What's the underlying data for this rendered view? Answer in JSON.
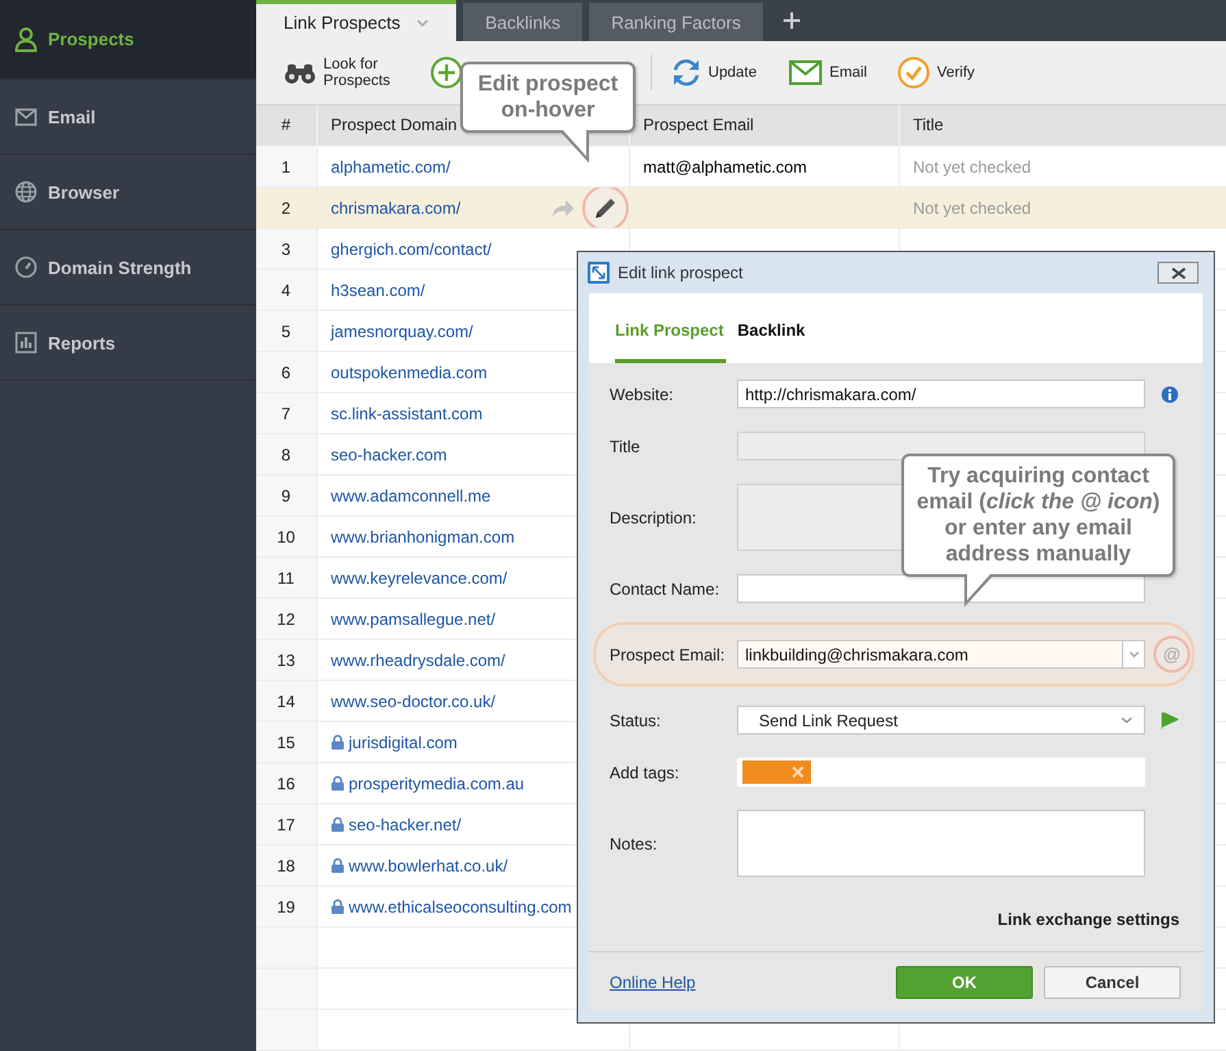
{
  "sidebar": {
    "items": [
      {
        "label": "Prospects",
        "selected": true
      },
      {
        "label": "Email",
        "selected": false
      },
      {
        "label": "Browser",
        "selected": false
      },
      {
        "label": "Domain Strength",
        "selected": false
      },
      {
        "label": "Reports",
        "selected": false
      }
    ]
  },
  "tabs": [
    {
      "label": "Link Prospects",
      "selected": true
    },
    {
      "label": "Backlinks",
      "selected": false
    },
    {
      "label": "Ranking Factors",
      "selected": false
    }
  ],
  "toolbar": {
    "items": [
      {
        "kind": "look",
        "label": "Look for Prospects"
      },
      {
        "kind": "add"
      },
      {
        "kind": "update",
        "label": "Update"
      },
      {
        "kind": "email",
        "label": "Email"
      },
      {
        "kind": "verify",
        "label": "Verify"
      }
    ]
  },
  "table": {
    "columns": [
      "#",
      "Prospect Domain",
      "Prospect Email",
      "Title"
    ],
    "rows": [
      {
        "number": "1",
        "domain": "alphametic.com/",
        "email": "matt@alphametic.com",
        "title": "Not yet checked",
        "locked": false,
        "selected": false
      },
      {
        "number": "2",
        "domain": "chrismakara.com/",
        "title": "Not yet checked",
        "locked": false,
        "selected": true
      },
      {
        "number": "3",
        "domain": "ghergich.com/contact/",
        "locked": false,
        "selected": false
      },
      {
        "number": "4",
        "domain": "h3sean.com/",
        "locked": false,
        "selected": false
      },
      {
        "number": "5",
        "domain": "jamesnorquay.com/",
        "locked": false,
        "selected": false
      },
      {
        "number": "6",
        "domain": "outspokenmedia.com",
        "locked": false,
        "selected": false
      },
      {
        "number": "7",
        "domain": "sc.link-assistant.com",
        "locked": false,
        "selected": false
      },
      {
        "number": "8",
        "domain": "seo-hacker.com",
        "locked": false,
        "selected": false
      },
      {
        "number": "9",
        "domain": "www.adamconnell.me",
        "locked": false,
        "selected": false
      },
      {
        "number": "10",
        "domain": "www.brianhonigman.com",
        "locked": false,
        "selected": false
      },
      {
        "number": "11",
        "domain": "www.keyrelevance.com/",
        "locked": false,
        "selected": false
      },
      {
        "number": "12",
        "domain": "www.pamsallegue.net/",
        "locked": false,
        "selected": false
      },
      {
        "number": "13",
        "domain": "www.rheadrysdale.com/",
        "locked": false,
        "selected": false
      },
      {
        "number": "14",
        "domain": "www.seo-doctor.co.uk/",
        "locked": false,
        "selected": false
      },
      {
        "number": "15",
        "domain": "jurisdigital.com",
        "locked": true,
        "selected": false
      },
      {
        "number": "16",
        "domain": "prosperitymedia.com.au",
        "locked": true,
        "selected": false
      },
      {
        "number": "17",
        "domain": "seo-hacker.net/",
        "locked": true,
        "selected": false
      },
      {
        "number": "18",
        "domain": "www.bowlerhat.co.uk/",
        "locked": true,
        "selected": false
      },
      {
        "number": "19",
        "domain": "www.ethicalseoconsulting.com",
        "locked": true,
        "selected": false
      }
    ]
  },
  "callouts": [
    {
      "text": "Edit prospect on-hover"
    },
    {
      "text": "Try acquiring contact email (*click the @ icon*) or enter any email address manually"
    }
  ],
  "dialog": {
    "title": "Edit link prospect",
    "tabs": [
      {
        "label": "Link Prospect",
        "selected": true
      },
      {
        "label": "Backlink",
        "selected": false
      }
    ],
    "fields": [
      {
        "kind": "url",
        "label": "Website:",
        "value": "http://chrismakara.com/",
        "disabled": false,
        "highlighted": false
      },
      {
        "kind": "text",
        "label": "Title",
        "disabled": true,
        "highlighted": false
      },
      {
        "kind": "textarea",
        "label": "Description:",
        "disabled": true,
        "highlighted": false
      },
      {
        "kind": "text",
        "label": "Contact Name:",
        "disabled": false,
        "highlighted": false
      },
      {
        "kind": "email",
        "label": "Prospect Email:",
        "value": "linkbuilding@chrismakara.com",
        "action": "@",
        "disabled": false,
        "highlighted": true
      },
      {
        "kind": "select",
        "label": "Status:",
        "value": "Send Link Request",
        "disabled": false,
        "highlighted": false
      },
      {
        "kind": "tags",
        "label": "Add tags:",
        "tags": [
          {
            "removable": true
          }
        ],
        "disabled": false,
        "highlighted": false
      },
      {
        "kind": "textarea",
        "label": "Notes:",
        "disabled": false,
        "highlighted": false
      }
    ],
    "settings_label": "Link exchange settings",
    "help_link": "Online Help",
    "buttons": [
      {
        "label": "OK",
        "primary": true
      },
      {
        "label": "Cancel",
        "primary": false
      }
    ]
  }
}
